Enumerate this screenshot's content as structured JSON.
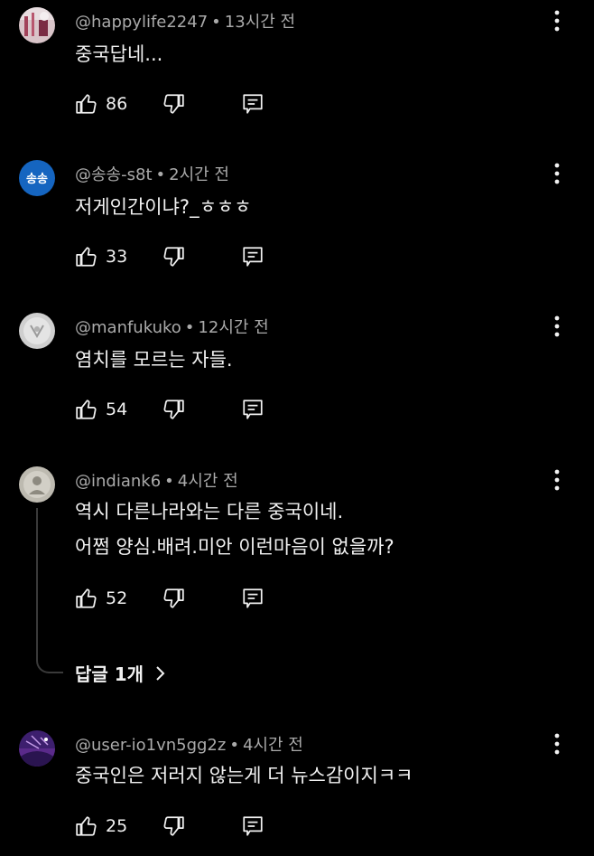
{
  "comments": [
    {
      "author": "@happylife2247",
      "time": "13시간 전",
      "lines": [
        "중국답네..."
      ],
      "likes": "86",
      "avatar": {
        "kind": "image",
        "bg": "#d9c4c9",
        "fg": "#a2425a"
      }
    },
    {
      "author": "@송송-s8t",
      "time": "2시간 전",
      "lines": [
        "저게인간이냐?_ㅎㅎㅎ"
      ],
      "likes": "33",
      "avatar": {
        "kind": "text",
        "text": "송송",
        "bg": "#1565c0",
        "fg": "#ffffff"
      }
    },
    {
      "author": "@manfukuko",
      "time": "12시간 전",
      "lines": [
        "염치를 모르는 자들."
      ],
      "likes": "54",
      "avatar": {
        "kind": "image",
        "bg": "#cfcfcf",
        "fg": "#9a9a9a"
      }
    },
    {
      "author": "@indiank6",
      "time": "4시간 전",
      "lines": [
        "역시 다른나라와는 다른 중국이네.",
        "어쩜 양심.배려.미안 이런마음이 없을까?"
      ],
      "likes": "52",
      "avatar": {
        "kind": "image",
        "bg": "#bdbab0",
        "fg": "#8d8a80"
      }
    },
    {
      "author": "@user-io1vn5gg2z",
      "time": "4시간 전",
      "lines": [
        "중국인은 저러지 않는게 더 뉴스감이지ㅋㅋ"
      ],
      "likes": "25",
      "avatar": {
        "kind": "image",
        "bg": "#3d1f6e",
        "fg": "#c59be8"
      }
    }
  ],
  "replies_link": {
    "label": "답글 1개",
    "chevron": "chevron-right-icon"
  },
  "icons": {
    "like": "thumbs-up-icon",
    "dislike": "thumbs-down-icon",
    "reply": "reply-comment-icon",
    "more": "more-vertical-icon"
  },
  "colors": {
    "background": "#000000",
    "text": "#f1f1f1",
    "meta": "#aaaaaa"
  }
}
